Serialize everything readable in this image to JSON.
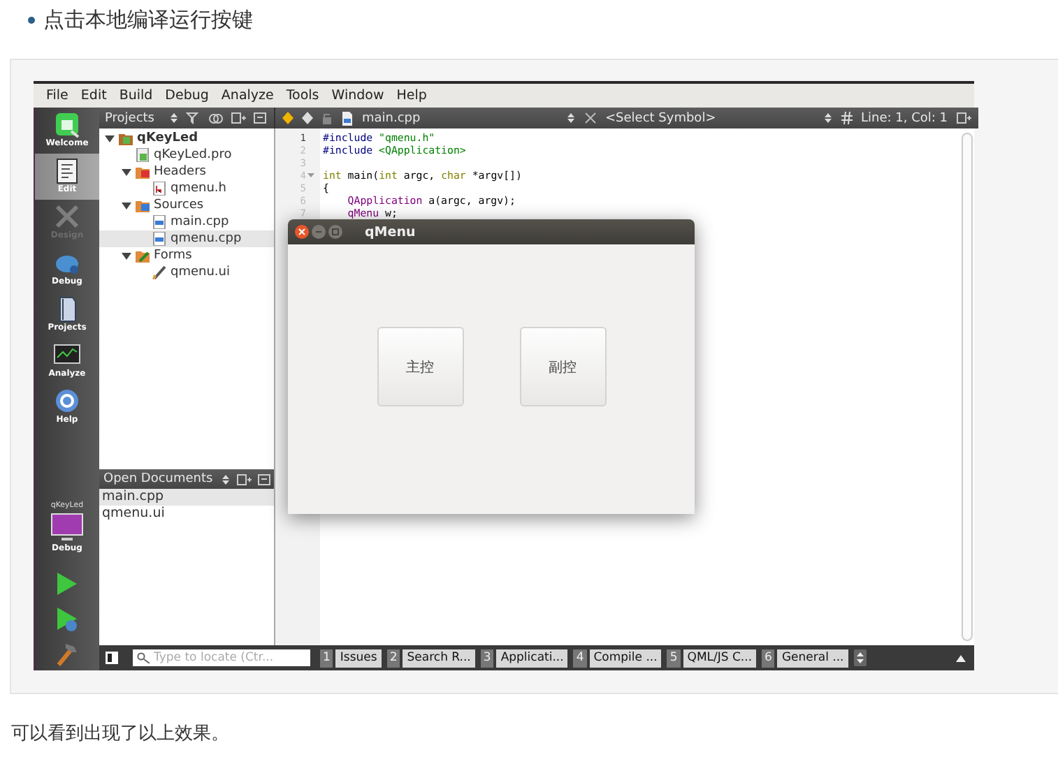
{
  "intro": {
    "text": "点击本地编译运行按键"
  },
  "ide": {
    "menu": [
      "File",
      "Edit",
      "Build",
      "Debug",
      "Analyze",
      "Tools",
      "Window",
      "Help"
    ],
    "modes": [
      {
        "label": "Welcome",
        "kind": "welcome",
        "selected": false,
        "disabled": false
      },
      {
        "label": "Edit",
        "kind": "edit",
        "selected": true,
        "disabled": false
      },
      {
        "label": "Design",
        "kind": "design",
        "selected": false,
        "disabled": true
      },
      {
        "label": "Debug",
        "kind": "debug",
        "selected": false,
        "disabled": false
      },
      {
        "label": "Projects",
        "kind": "projects",
        "selected": false,
        "disabled": false
      },
      {
        "label": "Analyze",
        "kind": "analyze",
        "selected": false,
        "disabled": false
      },
      {
        "label": "Help",
        "kind": "help",
        "selected": false,
        "disabled": false
      }
    ],
    "target": {
      "project": "qKeyLed",
      "config": "Debug"
    },
    "projects": {
      "title": "Projects",
      "tree": [
        {
          "label": "qKeyLed",
          "kind": "project",
          "expanded": true,
          "selected": false,
          "children": [
            {
              "label": "qKeyLed.pro",
              "kind": "pro",
              "selected": false
            },
            {
              "label": "Headers",
              "kind": "headers",
              "expanded": true,
              "selected": false,
              "children": [
                {
                  "label": "qmenu.h",
                  "kind": "header",
                  "selected": false
                }
              ]
            },
            {
              "label": "Sources",
              "kind": "sources",
              "expanded": true,
              "selected": false,
              "children": [
                {
                  "label": "main.cpp",
                  "kind": "source",
                  "selected": false
                },
                {
                  "label": "qmenu.cpp",
                  "kind": "source",
                  "selected": true
                }
              ]
            },
            {
              "label": "Forms",
              "kind": "forms",
              "expanded": true,
              "selected": false,
              "children": [
                {
                  "label": "qmenu.ui",
                  "kind": "form",
                  "selected": false
                }
              ]
            }
          ]
        }
      ]
    },
    "open_documents": {
      "title": "Open Documents",
      "items": [
        {
          "label": "main.cpp",
          "selected": true
        },
        {
          "label": "qmenu.ui",
          "selected": false
        }
      ]
    },
    "editor": {
      "file": "main.cpp",
      "symbol": "<Select Symbol>",
      "position": "Line: 1, Col: 1",
      "lines": [
        {
          "number": "1",
          "current": true,
          "fold": false,
          "tokens": [
            {
              "kind": "pre",
              "text": "#include"
            },
            {
              "kind": "str",
              "text": " \"qmenu.h\""
            }
          ]
        },
        {
          "number": "2",
          "current": false,
          "fold": false,
          "tokens": [
            {
              "kind": "pre",
              "text": "#include"
            },
            {
              "kind": "str",
              "text": " <QApplication>"
            }
          ]
        },
        {
          "number": "3",
          "current": false,
          "fold": false
        },
        {
          "number": "4",
          "current": false,
          "fold": true,
          "tokens": [
            {
              "kind": "kw",
              "text": "int"
            },
            {
              "kind": "plain",
              "text": " main("
            },
            {
              "kind": "kw",
              "text": "int"
            },
            {
              "kind": "plain",
              "text": " argc, "
            },
            {
              "kind": "kw",
              "text": "char"
            },
            {
              "kind": "plain",
              "text": " *argv[])"
            }
          ]
        },
        {
          "number": "5",
          "current": false,
          "fold": false,
          "tokens": [
            {
              "kind": "plain",
              "text": "{"
            }
          ]
        },
        {
          "number": "6",
          "current": false,
          "fold": false,
          "tokens": [
            {
              "kind": "type",
              "text": "    QApplication"
            },
            {
              "kind": "plain",
              "text": " a(argc, argv);"
            }
          ]
        },
        {
          "number": "7",
          "current": false,
          "fold": false,
          "tokens": [
            {
              "kind": "type",
              "text": "    qMenu"
            },
            {
              "kind": "plain",
              "text": " w;"
            }
          ]
        }
      ]
    },
    "locator": {
      "placeholder": "Type to locate (Ctr..."
    },
    "output_panes": [
      {
        "number": "1",
        "label": "Issues"
      },
      {
        "number": "2",
        "label": "Search R..."
      },
      {
        "number": "3",
        "label": "Applicati..."
      },
      {
        "number": "4",
        "label": "Compile ..."
      },
      {
        "number": "5",
        "label": "QML/JS C..."
      },
      {
        "number": "6",
        "label": "General ..."
      }
    ]
  },
  "dialog": {
    "title": "qMenu",
    "buttons": [
      "主控",
      "副控"
    ]
  },
  "caption": {
    "text": "可以看到出现了以上效果。"
  }
}
